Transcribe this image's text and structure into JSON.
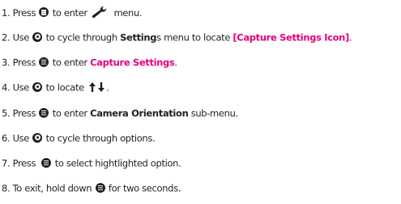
{
  "colors": {
    "text": "#231f20",
    "accent": "#e6007e"
  },
  "steps": [
    {
      "n": "1. Press",
      "t1": "to enter",
      "t2": "menu."
    },
    {
      "n": "2. Use",
      "t1": "to cycle through",
      "b1": "Setting",
      "t2": "s menu to locate",
      "p1": "[Capture Settings Icon]",
      "t3": "."
    },
    {
      "n": "3. Press",
      "t1": "to enter",
      "p1": "Capture Settings",
      "t2": "."
    },
    {
      "n": "4. Use",
      "t1": "to locate",
      "t2": "."
    },
    {
      "n": "5. Press",
      "t1": "to enter",
      "b1": "Camera Orientation",
      "t2": "sub-menu."
    },
    {
      "n": "6. Use",
      "t1": "to cycle through options."
    },
    {
      "n": "7. Press",
      "t1": "to select hightlighted option."
    },
    {
      "n": "8. To exit, hold down",
      "t1": "for two seconds."
    }
  ],
  "icons": {
    "select_button": "shutter-select-button-icon",
    "mode_button": "power-mode-button-icon",
    "settings": "wrench-icon",
    "orientation": "up-down-arrows-icon"
  }
}
